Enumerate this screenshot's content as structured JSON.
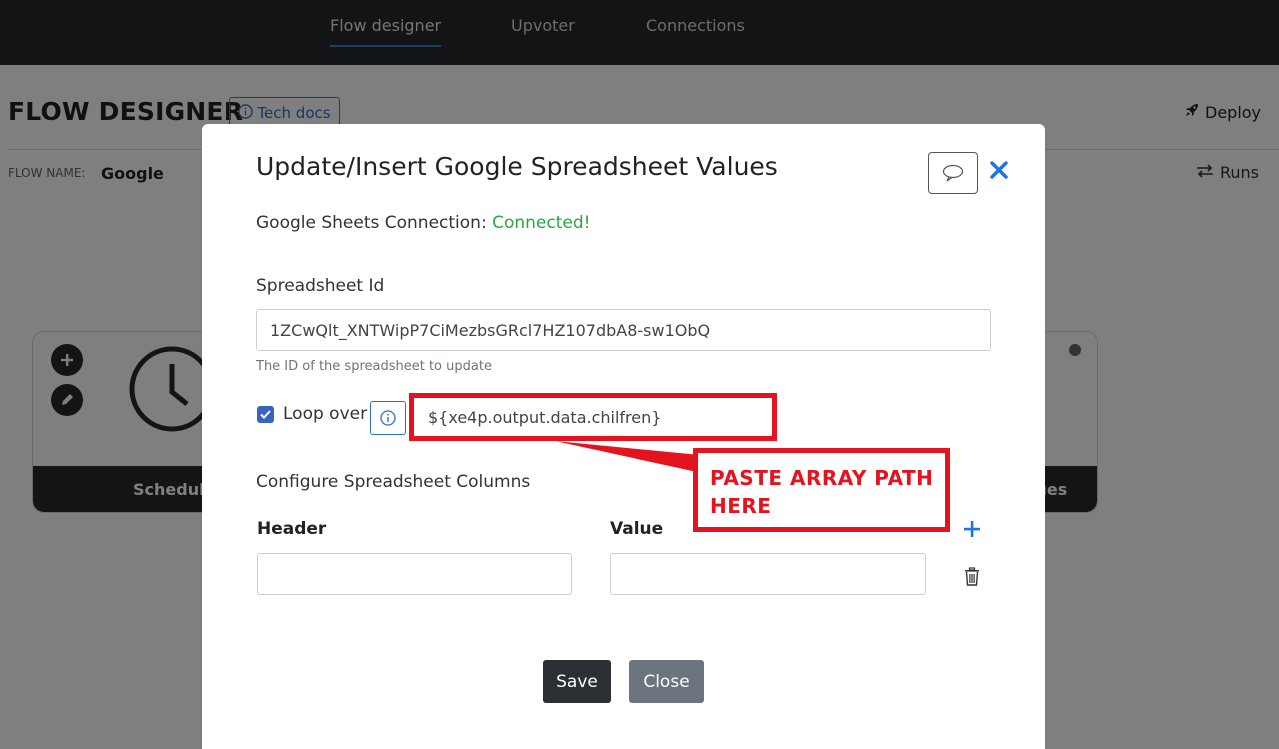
{
  "nav": {
    "items": [
      {
        "label": "Flow designer",
        "active": true
      },
      {
        "label": "Upvoter",
        "active": false
      },
      {
        "label": "Connections",
        "active": false
      }
    ]
  },
  "page": {
    "title": "FLOW DESIGNER",
    "tech_docs": "Tech docs",
    "deploy": "Deploy",
    "flow_name_label": "FLOW NAME:",
    "flow_name": "Google",
    "runs": "Runs",
    "cards": [
      {
        "label": "Schedule"
      },
      {
        "label": "lues"
      }
    ]
  },
  "modal": {
    "title": "Update/Insert Google Spreadsheet Values",
    "connection_label": "Google Sheets Connection:",
    "connection_status": "Connected!",
    "spreadsheet_id_label": "Spreadsheet Id",
    "spreadsheet_id_value": "1ZCwQlt_XNTWipP7CiMezbsGRcl7HZ107dbA8-sw1ObQ",
    "spreadsheet_id_help": "The ID of the spreadsheet to update",
    "loop_over_label": "Loop over",
    "loop_over_checked": true,
    "loop_over_value": "${xe4p.output.data.chilfren}",
    "columns_label": "Configure Spreadsheet Columns",
    "header_col": "Header",
    "value_col": "Value",
    "rows": [
      {
        "header": "",
        "value": ""
      }
    ],
    "save_label": "Save",
    "close_label": "Close"
  },
  "annotation": {
    "callout_text": "PASTE ARRAY PATH HERE",
    "color": "#e3141f"
  },
  "colors": {
    "nav_bg": "#24282d",
    "accent": "#3d7fd0",
    "success": "#28a745",
    "link": "#2f6fbf"
  },
  "icons": {
    "tech_docs": "info-circle-icon",
    "deploy": "rocket-icon",
    "runs": "arrows-exchange-icon",
    "comment": "speech-bubble-icon",
    "close": "close-icon",
    "info": "info-circle-icon",
    "add": "plus-icon",
    "delete": "trash-icon",
    "clock": "clock-icon",
    "edit": "pencil-icon"
  }
}
